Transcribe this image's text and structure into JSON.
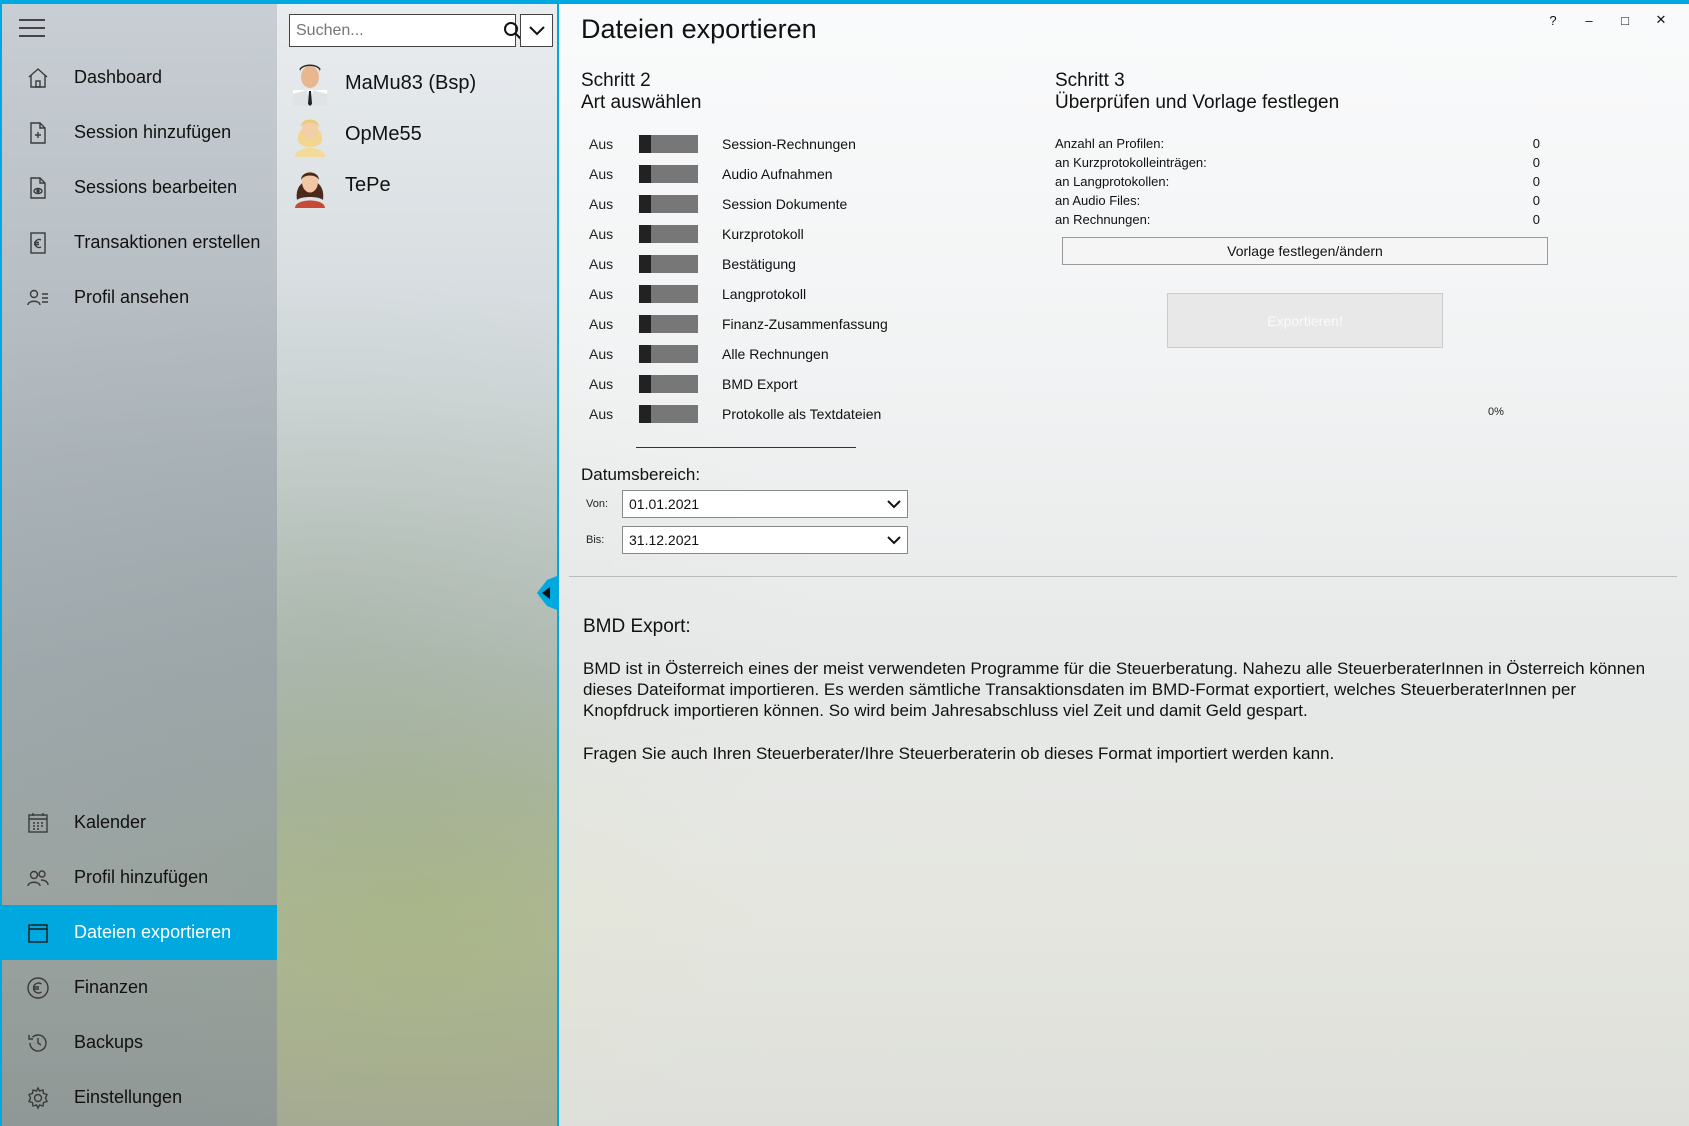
{
  "sidebar": {
    "items": [
      {
        "label": "Dashboard",
        "icon": "home-icon"
      },
      {
        "label": "Session hinzufügen",
        "icon": "add-document-icon"
      },
      {
        "label": "Sessions bearbeiten",
        "icon": "edit-document-icon"
      },
      {
        "label": "Transaktionen erstellen",
        "icon": "euro-document-icon"
      },
      {
        "label": "Profil ansehen",
        "icon": "profile-list-icon"
      },
      {
        "label": "Kalender",
        "icon": "calendar-icon"
      },
      {
        "label": "Profil hinzufügen",
        "icon": "add-people-icon"
      },
      {
        "label": "Dateien exportieren",
        "icon": "export-window-icon"
      },
      {
        "label": "Finanzen",
        "icon": "euro-circle-icon"
      },
      {
        "label": "Backups",
        "icon": "history-icon"
      },
      {
        "label": "Einstellungen",
        "icon": "gear-icon"
      }
    ],
    "active_index": 7,
    "accent_color": "#00a8e0"
  },
  "profiles": {
    "search_placeholder": "Suchen...",
    "list": [
      {
        "name": "MaMu83 (Bsp)"
      },
      {
        "name": "OpMe55"
      },
      {
        "name": "TePe"
      }
    ]
  },
  "window": {
    "help": "?",
    "minimize": "–",
    "maximize": "□",
    "close": "✕"
  },
  "main": {
    "title": "Dateien exportieren",
    "step2": {
      "title": "Schritt 2",
      "subtitle": "Art auswählen"
    },
    "step3": {
      "title": "Schritt 3",
      "subtitle": "Überprüfen und Vorlage festlegen"
    },
    "toggles": [
      {
        "state": "Aus",
        "label": "Session-Rechnungen"
      },
      {
        "state": "Aus",
        "label": "Audio Aufnahmen"
      },
      {
        "state": "Aus",
        "label": "Session Dokumente"
      },
      {
        "state": "Aus",
        "label": "Kurzprotokoll"
      },
      {
        "state": "Aus",
        "label": "Bestätigung"
      },
      {
        "state": "Aus",
        "label": "Langprotokoll"
      },
      {
        "state": "Aus",
        "label": "Finanz-Zusammenfassung"
      },
      {
        "state": "Aus",
        "label": "Alle Rechnungen"
      },
      {
        "state": "Aus",
        "label": "BMD Export"
      },
      {
        "state": "Aus",
        "label": "Protokolle als Textdateien"
      }
    ],
    "date_range": {
      "heading": "Datumsbereich:",
      "from_label": "Von:",
      "from_value": "01.01.2021",
      "to_label": "Bis:",
      "to_value": "31.12.2021"
    },
    "stats": [
      {
        "label": "Anzahl an Profilen:",
        "value": "0"
      },
      {
        "label": "an Kurzprotokolleinträgen:",
        "value": "0"
      },
      {
        "label": "an Langprotokollen:",
        "value": "0"
      },
      {
        "label": "an Audio Files:",
        "value": "0"
      },
      {
        "label": "an Rechnungen:",
        "value": "0"
      }
    ],
    "template_button": "Vorlage festlegen/ändern",
    "export_button": "Exportieren!",
    "progress": "0%",
    "info_title": "BMD Export:",
    "info_paragraph1": "BMD ist in Österreich eines der meist verwendeten Programme für die Steuerberatung. Nahezu alle SteuerberaterInnen in Österreich können dieses Dateiformat importieren. Es werden sämtliche Transaktionsdaten im BMD-Format exportiert, welches SteuerberaterInnen per Knopfdruck importieren können. So wird beim Jahresabschluss viel Zeit und damit Geld gespart.",
    "info_paragraph2": "Fragen Sie auch Ihren Steuerberater/Ihre Steuerberaterin ob dieses Format importiert werden kann."
  }
}
